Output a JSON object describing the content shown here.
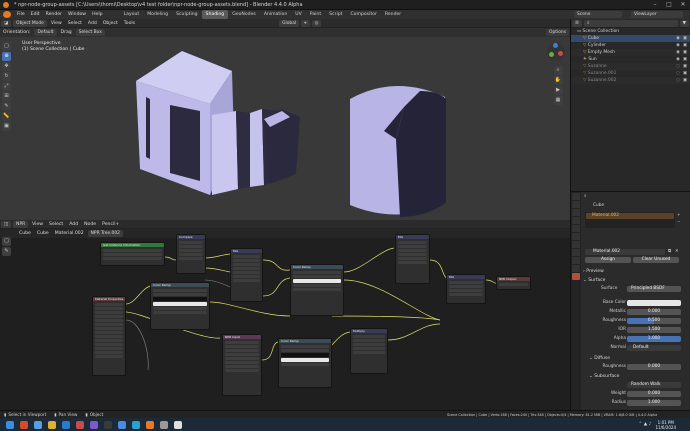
{
  "title_bar": {
    "title": "* npr-node-group-assets [C:\\Users\\thomi\\Desktop\\v4 test folder\\npr-node-group-assets.blend] - Blender 4.4.0 Alpha"
  },
  "menu": {
    "items": [
      "File",
      "Edit",
      "Render",
      "Window",
      "Help"
    ],
    "workspaces": [
      "Layout",
      "Modeling",
      "Sculpting",
      "Shading",
      "GeoNodes",
      "Animation",
      "UV",
      "Paint",
      "Script",
      "Compositor",
      "Render"
    ],
    "active_workspace": "Shading",
    "scene_label": "Scene",
    "view_layer_label": "ViewLayer"
  },
  "viewport": {
    "mode": "Object Mode",
    "menus": [
      "View",
      "Select",
      "Add",
      "Object",
      "Tools"
    ],
    "transform": "Global",
    "orientation_label": "Orientation:",
    "orientation_value": "Default",
    "drag_label": "Drag",
    "select_box": "Select Box",
    "options_label": "Options",
    "overlay_line1": "User Perspective",
    "overlay_line2": "(1) Scene Collection | Cube"
  },
  "node_editor": {
    "type": "NPR",
    "menus": [
      "View",
      "Select",
      "Add",
      "Node"
    ],
    "extra_label": "Pencil+",
    "breadcrumb": [
      "Cube",
      "Cube",
      "Material.002"
    ],
    "tree_name": "NPR Tree.002",
    "nodes": {
      "compare": "Compare",
      "instance_info": "Get Instance Information",
      "math": "Mix",
      "color_ramp": "Color Ramp",
      "npr_output": "NPR Output",
      "group_input": "Material Properties",
      "npr_input": "NPR Input",
      "color_ramp2": "Color Ramp",
      "color_ramp3": "Color Ramp",
      "mix2": "Mix",
      "mix3": "Mix",
      "multiply": "Multiply"
    }
  },
  "outliner": {
    "root": "Scene Collection",
    "items": [
      "Cube",
      "Cylinder",
      "Empty Mesh",
      "Sun",
      "Suzanne",
      "Suzanne.001",
      "Suzanne.002"
    ]
  },
  "properties": {
    "object": "Cube",
    "material_slot": "Material.002",
    "material_name": "Material.002",
    "assign": "Assign",
    "select": "Select",
    "deselect": "Deselect",
    "clear_unused": "Clear Unused",
    "preview": "Preview",
    "surface": "Surface",
    "surface_value": "Principled BSDF",
    "fields": [
      {
        "label": "Base Color",
        "value": ""
      },
      {
        "label": "Metallic",
        "value": "0.000"
      },
      {
        "label": "Roughness",
        "value": "0.500"
      },
      {
        "label": "IOR",
        "value": "1.500"
      },
      {
        "label": "Alpha",
        "value": "1.000"
      },
      {
        "label": "Normal",
        "value": "Default"
      }
    ],
    "diffuse": "Diffuse",
    "diffuse_roughness_label": "Roughness",
    "diffuse_roughness_value": "0.000",
    "subsurface": "Subsurface",
    "subsurface_method": "Random Walk",
    "weight_label": "Weight",
    "weight_value": "0.000",
    "radius_label": "Radius",
    "radius_value": "1.000"
  },
  "status_bar": {
    "left": [
      "Select in Viewport",
      "Pan View",
      "Object"
    ],
    "right": "Scene Collection | Cube | Verts:168 | Faces:240 | Tris:348 | Objects:0/4 | Memory: 81.2 MiB | VRAM: 1.6/8.0 GiB | 4.4.0 Alpha"
  },
  "taskbar": {
    "time": "1:01 PM",
    "date": "11/6/2024"
  },
  "colors": {
    "accent": "#4772b3",
    "active_workspace": "#5a5a5a",
    "object_color": "#b7b3e6",
    "active_tab_orange": "#e09a3a"
  }
}
